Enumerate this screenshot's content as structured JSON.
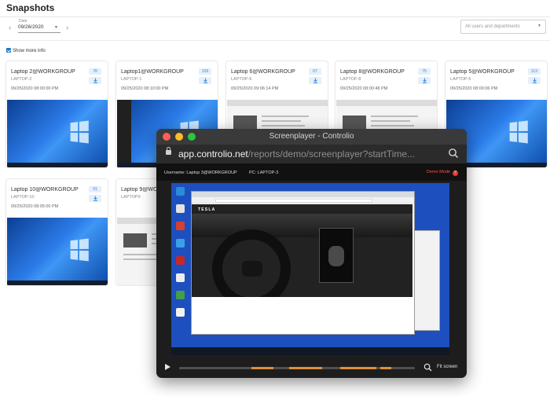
{
  "page": {
    "title": "Snapshots"
  },
  "filters": {
    "date_label": "Date",
    "date_value": "09/26/2020",
    "users_placeholder": "All users and departments"
  },
  "show_more": {
    "label": "Show more info",
    "checked": true
  },
  "snapshots": [
    {
      "title": "Laptop 2@WORKGROUP",
      "pc": "LAPTOP-2",
      "time": "09/25/2020 08:00:00 PM",
      "count": "78",
      "thumb": "windows"
    },
    {
      "title": "Laptop1@WORKGROUP",
      "pc": "LAPTOP-1",
      "time": "09/25/2020 08:10:00 PM",
      "count": "109",
      "thumb": "windows-dark"
    },
    {
      "title": "Laptop 6@WORKGROUP",
      "pc": "LAPTOP-6",
      "time": "09/25/2020 09:06:14 PM",
      "count": "67",
      "thumb": "web"
    },
    {
      "title": "Laptop 8@WORKGROUP",
      "pc": "LAPTOP-8",
      "time": "09/25/2020 08:00:48 PM",
      "count": "75",
      "thumb": "web"
    },
    {
      "title": "Laptop 5@WORKGROUP",
      "pc": "LAPTOP-5",
      "time": "09/25/2020 08:00:06 PM",
      "count": "113",
      "thumb": "windows"
    },
    {
      "title": "Laptop 10@WORKGROUP",
      "pc": "LAPTOP-10",
      "time": "09/25/2020 08:05:00 PM",
      "count": "91",
      "thumb": "windows"
    },
    {
      "title": "Laptop 9@WORKGROUP",
      "pc": "LAPTOP9",
      "time": "",
      "count": "",
      "thumb": "web"
    }
  ],
  "player": {
    "window_title": "Screenplayer - Controlio",
    "url_host": "app.controlio.net",
    "url_path": "/reports/demo/screenplayer?startTime...",
    "username_line": "Username: Laptop 3@WORKGROUP",
    "pc_line": "PC: LAPTOP-3",
    "demo_label": "Demo Mode",
    "video_brand": "TESLA",
    "fit_label": "Fit screen",
    "progress": 0.0
  },
  "icons": {
    "prev": "chevron-left-icon",
    "next": "chevron-right-icon",
    "download": "download-icon",
    "lock": "lock-icon",
    "search": "search-icon",
    "zoom": "zoom-icon",
    "play": "play-icon",
    "help": "help-icon"
  },
  "colors": {
    "accent": "#1e76c8",
    "badge_bg": "#e4f0fb",
    "badge_text": "#3b8be0",
    "timeline_activity": "#e0903a",
    "demo_red": "#ff4e4e",
    "traffic_red": "#ff5f57",
    "traffic_yellow": "#febc2e",
    "traffic_green": "#28c840"
  }
}
